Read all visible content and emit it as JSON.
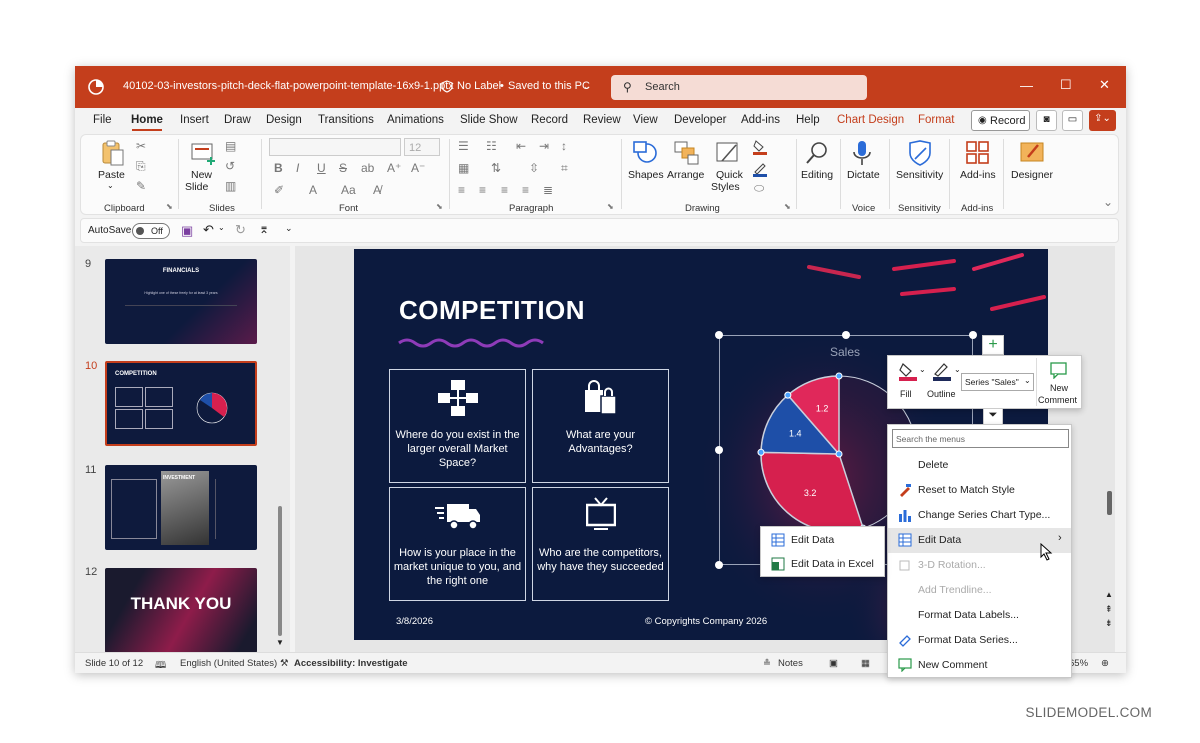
{
  "titlebar": {
    "filename": "40102-03-investors-pitch-deck-flat-powerpoint-template-16x9-1.pptx",
    "label_status": "No Label",
    "save_status": "Saved to this PC",
    "search_placeholder": "Search"
  },
  "menu": {
    "items": [
      "File",
      "Home",
      "Insert",
      "Draw",
      "Design",
      "Transitions",
      "Animations",
      "Slide Show",
      "Record",
      "Review",
      "View",
      "Developer",
      "Add-ins",
      "Help",
      "Chart Design",
      "Format"
    ],
    "active": "Home",
    "record_label": "Record"
  },
  "ribbon": {
    "clipboard": {
      "paste": "Paste",
      "group": "Clipboard"
    },
    "slides": {
      "new_slide_1": "New",
      "new_slide_2": "Slide",
      "group": "Slides"
    },
    "font": {
      "size": "12",
      "group": "Font"
    },
    "paragraph": {
      "group": "Paragraph"
    },
    "drawing": {
      "shapes": "Shapes",
      "arrange": "Arrange",
      "quick_styles_1": "Quick",
      "quick_styles_2": "Styles",
      "group": "Drawing"
    },
    "editing": {
      "label": "Editing"
    },
    "voice": {
      "dictate": "Dictate",
      "group": "Voice"
    },
    "sensitivity": {
      "label": "Sensitivity",
      "group": "Sensitivity"
    },
    "addins": {
      "label": "Add-ins",
      "group": "Add-ins"
    },
    "designer": {
      "label": "Designer"
    }
  },
  "quick_access": {
    "autosave_label": "AutoSave",
    "toggle_state": "Off"
  },
  "thumbnails": [
    {
      "number": "9",
      "title": "FINANCIALS",
      "subtitle": "Highlight one of these freely for at least 3 years"
    },
    {
      "number": "10",
      "title": "COMPETITION"
    },
    {
      "number": "11",
      "title": "INVESTMENT"
    },
    {
      "number": "12",
      "title": "THANK YOU"
    }
  ],
  "slide": {
    "title": "COMPETITION",
    "cards": [
      "Where do you exist in the larger overall Market Space?",
      "What are your Advantages?",
      "How is your place in the market unique to you, and the right one",
      "Who are the competitors, why have they succeeded"
    ],
    "date": "3/8/2026",
    "copyright": "© Copyrights Company 2026"
  },
  "chart_data": {
    "type": "pie",
    "title": "Sales",
    "categories": [
      "",
      "",
      ""
    ],
    "values": [
      3.2,
      1.4,
      1.2
    ],
    "colors": [
      "#d6204e",
      "#1e4fa8",
      "#e0285a"
    ]
  },
  "mini_toolbar": {
    "fill": "Fill",
    "outline": "Outline",
    "series_select": "Series \"Sales\"",
    "new_comment_1": "New",
    "new_comment_2": "Comment"
  },
  "context_menu": {
    "search_placeholder": "Search the menus",
    "items": [
      {
        "label": "Delete",
        "disabled": false
      },
      {
        "label": "Reset to Match Style",
        "disabled": false
      },
      {
        "label": "Change Series Chart Type...",
        "disabled": false
      },
      {
        "label": "Edit Data",
        "disabled": false
      },
      {
        "label": "3-D Rotation...",
        "disabled": true
      },
      {
        "label": "Add Trendline...",
        "disabled": true
      },
      {
        "label": "Format Data Labels...",
        "disabled": false
      },
      {
        "label": "Format Data Series...",
        "disabled": false
      },
      {
        "label": "New Comment",
        "disabled": false
      }
    ]
  },
  "submenu": {
    "items": [
      "Edit Data",
      "Edit Data in Excel"
    ]
  },
  "statusbar": {
    "slide_pos": "Slide 10 of 12",
    "language": "English (United States)",
    "accessibility": "Accessibility: Investigate",
    "notes": "Notes",
    "zoom": "65%"
  },
  "watermark": "SLIDEMODEL.COM",
  "colors": {
    "accent": "#c43e1c",
    "slide_bg": "#0c1a3e",
    "pie_red": "#d6204e",
    "pie_blue": "#1e4fa8"
  }
}
